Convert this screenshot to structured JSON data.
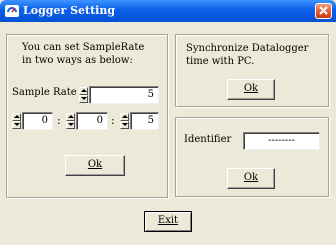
{
  "window": {
    "title": "Logger Setting"
  },
  "sample_rate_group": {
    "description_line1": "You can set SampleRate",
    "description_line2": "in two ways as below:",
    "sample_rate_label": "Sample Rate",
    "sample_rate_value": "5",
    "hours_value": "0",
    "minutes_value": "0",
    "seconds_value": "5",
    "separator": ":",
    "ok_label": "Ok"
  },
  "sync_group": {
    "description_line1": "Synchronize Datalogger",
    "description_line2": "time with PC.",
    "ok_label": "Ok"
  },
  "identifier_group": {
    "label": "Identifier",
    "value": "--------",
    "ok_label": "Ok"
  },
  "exit_label": "Exit",
  "icons": {
    "title_icon": "logger-icon",
    "close": "close-icon",
    "spinner": "spinner-icon"
  },
  "colors": {
    "titlebar": "#0a5fe8",
    "dialog_bg": "#ece9d8",
    "close_button": "#e15430"
  }
}
